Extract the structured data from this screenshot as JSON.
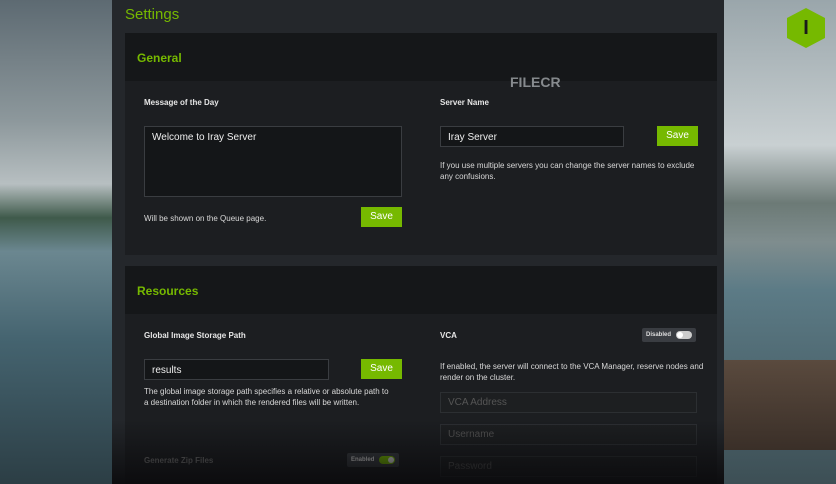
{
  "title": "Settings",
  "general": {
    "heading": "General",
    "motd": {
      "label": "Message of the Day",
      "value": "Welcome to Iray Server",
      "hint": "Will be shown on the Queue page.",
      "save": "Save"
    },
    "server": {
      "label": "Server Name",
      "value": "Iray Server",
      "save": "Save",
      "hint": "If you use multiple servers you can change the server names to exclude any confusions."
    }
  },
  "resources": {
    "heading": "Resources",
    "storage": {
      "label": "Global Image Storage Path",
      "value": "results",
      "save": "Save",
      "hint": "The global image storage path specifies a relative or absolute path to a destination folder in which the rendered files will be written."
    },
    "zip": {
      "label": "Generate Zip Files",
      "toggle": "Enabled"
    },
    "vca": {
      "label": "VCA",
      "toggle": "Disabled",
      "hint": "If enabled, the server will connect to the VCA Manager, reserve nodes and render on the cluster.",
      "address_placeholder": "VCA Address",
      "username_placeholder": "Username",
      "password_placeholder": "Password"
    }
  },
  "watermark": "FILECR"
}
